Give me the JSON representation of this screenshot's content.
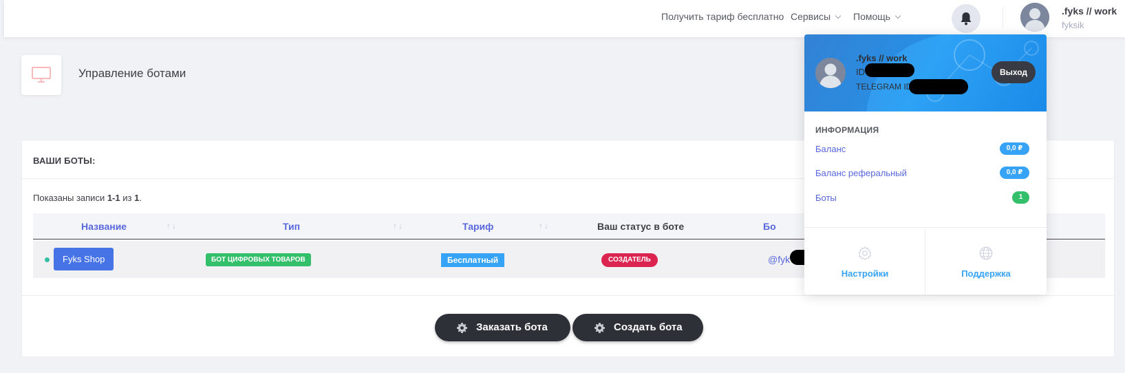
{
  "topbar": {
    "free_tariff": "Получить тариф бесплатно",
    "services": "Сервисы",
    "help": "Помощь",
    "user_name": ".fyks // work",
    "user_login": "fyksik"
  },
  "subheader": {
    "title": "Управление ботами"
  },
  "bots": {
    "title": "ВАШИ БОТЫ:",
    "summary_prefix": "Показаны записи ",
    "summary_range": "1-1",
    "summary_mid": " из ",
    "summary_total": "1",
    "summary_suffix": ".",
    "columns": {
      "name": "Название",
      "type": "Тип",
      "tariff": "Тариф",
      "status": "Ваш статус в боте",
      "bot": "Бо"
    },
    "sort_arrows": "↑↓",
    "rows": [
      {
        "name": "Fyks Shop",
        "type": "БОТ ЦИФРОВЫХ ТОВАРОВ",
        "tariff": "Бесплатный",
        "status": "СОЗДАТЕЛЬ",
        "bot_link": "@fyk"
      }
    ],
    "order_button": "Заказать бота",
    "create_button": "Создать бота"
  },
  "dropdown": {
    "name": ".fyks // work",
    "id_label": "ID",
    "telegram_label": "TELEGRAM ID",
    "logout": "Выход",
    "section_title": "ИНФОРМАЦИЯ",
    "items": [
      {
        "label": "Баланс",
        "value": "0,0 ₽"
      },
      {
        "label": "Баланс реферальный",
        "value": "0,0 ₽"
      },
      {
        "label": "Боты",
        "value": "1"
      }
    ],
    "footer": {
      "settings": "Настройки",
      "support": "Поддержка"
    }
  },
  "colors": {
    "accent": "#5867dd",
    "primary_button": "#4674e6",
    "success": "#34bf6a",
    "info": "#36a3f7",
    "danger": "#dc2450",
    "dark_button": "#2e3038"
  },
  "icons": {
    "bell": "bell-icon",
    "monitor": "monitor-icon",
    "gear": "gear-icon",
    "globe": "globe-icon",
    "avatar": "user-avatar"
  }
}
